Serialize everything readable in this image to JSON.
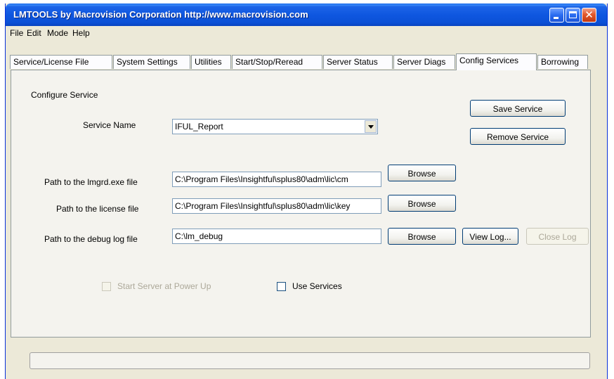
{
  "window": {
    "title": "LMTOOLS by Macrovision Corporation http://www.macrovision.com"
  },
  "menu": [
    "File",
    "Edit",
    "Mode",
    "Help"
  ],
  "tabs": [
    {
      "label": "Service/License File",
      "active": false
    },
    {
      "label": "System Settings",
      "active": false
    },
    {
      "label": "Utilities",
      "active": false
    },
    {
      "label": "Start/Stop/Reread",
      "active": false
    },
    {
      "label": "Server Status",
      "active": false
    },
    {
      "label": "Server Diags",
      "active": false
    },
    {
      "label": "Config Services",
      "active": true
    },
    {
      "label": "Borrowing",
      "active": false
    }
  ],
  "config": {
    "section_title": "Configure Service",
    "service_name_label": "Service Name",
    "service_name_value": "IFUL_Report",
    "lmgrd_label": "Path to the lmgrd.exe file",
    "lmgrd_value": "C:\\Program Files\\Insightful\\splus80\\adm\\lic\\cm",
    "license_label": "Path to the license file",
    "license_value": "C:\\Program Files\\Insightful\\splus80\\adm\\lic\\key",
    "debug_label": "Path to the debug log file",
    "debug_value": "C:\\lm_debug",
    "save_label": "Save Service",
    "remove_label": "Remove Service",
    "browse_label": "Browse",
    "view_log_label": "View Log...",
    "close_log_label": "Close Log",
    "start_at_powerup_label": "Start Server at Power Up",
    "start_at_powerup_checked": false,
    "use_services_label": "Use Services",
    "use_services_checked": false
  },
  "icons": {
    "minimize": "minimize-icon",
    "maximize": "maximize-icon",
    "close": "close-icon",
    "dropdown": "chevron-down-icon"
  }
}
